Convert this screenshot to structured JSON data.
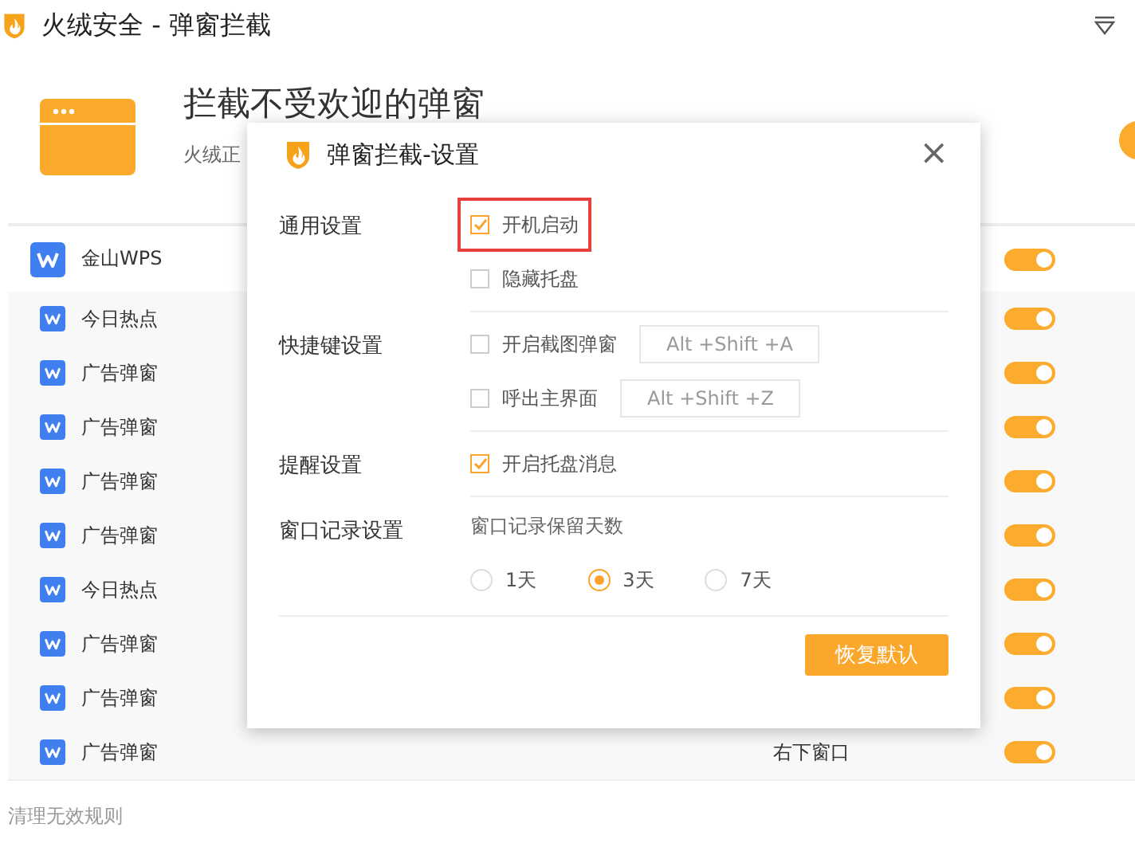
{
  "window": {
    "title": "火绒安全 - 弹窗拦截"
  },
  "header": {
    "heading": "拦截不受欢迎的弹窗",
    "subtitle": "火绒正"
  },
  "rules": [
    {
      "kind": "main",
      "name": "金山WPS",
      "on": true
    },
    {
      "kind": "sub",
      "name": "今日热点",
      "on": true
    },
    {
      "kind": "sub",
      "name": "广告弹窗",
      "on": true
    },
    {
      "kind": "sub",
      "name": "广告弹窗",
      "on": true
    },
    {
      "kind": "sub",
      "name": "广告弹窗",
      "on": true
    },
    {
      "kind": "sub",
      "name": "广告弹窗",
      "on": true
    },
    {
      "kind": "sub",
      "name": "今日热点",
      "on": true
    },
    {
      "kind": "sub",
      "name": "广告弹窗",
      "on": true
    },
    {
      "kind": "sub",
      "name": "广告弹窗",
      "on": true
    },
    {
      "kind": "sub",
      "name": "广告弹窗",
      "column_2": "右下窗口",
      "on": true
    }
  ],
  "footer_link": "清理无效规则",
  "dialog": {
    "title": "弹窗拦截-设置",
    "close": "×",
    "sections": [
      {
        "label": "通用设置",
        "items": [
          {
            "kind": "checkbox",
            "label": "开机启动",
            "checked": true,
            "highlighted": true
          },
          {
            "kind": "checkbox",
            "label": "隐藏托盘",
            "checked": false,
            "highlighted": false
          }
        ]
      },
      {
        "label": "快捷键设置",
        "items": [
          {
            "kind": "checkbox",
            "label": "开启截图弹窗",
            "checked": false,
            "highlighted": false,
            "shortcut": "Alt +Shift +A"
          },
          {
            "kind": "checkbox",
            "label": "呼出主界面",
            "checked": false,
            "highlighted": false,
            "shortcut": "Alt +Shift +Z"
          }
        ]
      },
      {
        "label": "提醒设置",
        "items": [
          {
            "kind": "checkbox",
            "label": "开启托盘消息",
            "checked": true,
            "highlighted": false
          }
        ]
      },
      {
        "label": "窗口记录设置",
        "items": [
          {
            "kind": "note",
            "text": "窗口记录保留天数"
          },
          {
            "kind": "radios",
            "options": [
              {
                "label": "1天",
                "selected": false
              },
              {
                "label": "3天",
                "selected": true
              },
              {
                "label": "7天",
                "selected": false
              }
            ]
          }
        ]
      }
    ],
    "button": "恢复默认"
  }
}
